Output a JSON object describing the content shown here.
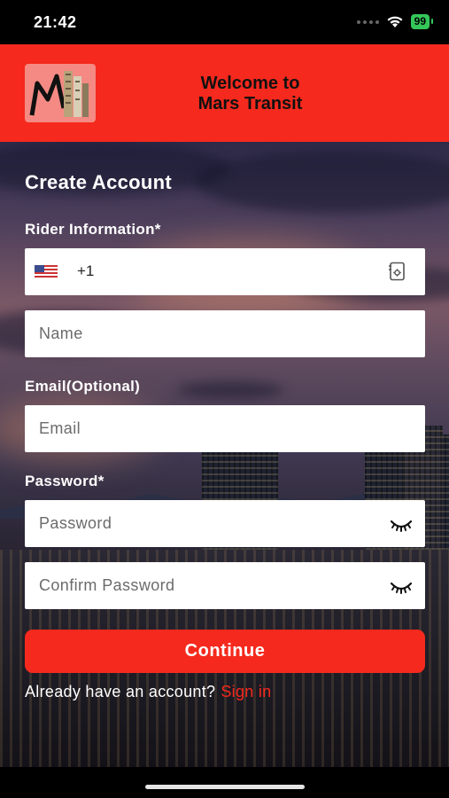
{
  "status_bar": {
    "time": "21:42",
    "battery": "99"
  },
  "header": {
    "title_line1": "Welcome to",
    "title_line2": "Mars Transit",
    "logo_icon": "mars-transit-logo"
  },
  "form": {
    "title": "Create Account",
    "rider_label": "Rider Information*",
    "phone": {
      "dial_code": "+1",
      "value": "",
      "flag_icon": "us-flag-icon",
      "contact_icon": "contact-book-icon"
    },
    "name": {
      "placeholder": "Name",
      "value": ""
    },
    "email_label": "Email(Optional)",
    "email": {
      "placeholder": "Email",
      "value": ""
    },
    "password_label": "Password*",
    "password": {
      "placeholder": "Password",
      "value": "",
      "toggle_icon": "eye-closed-icon"
    },
    "confirm_password": {
      "placeholder": "Confirm Password",
      "value": "",
      "toggle_icon": "eye-closed-icon"
    },
    "continue_label": "Continue",
    "signin_prompt": "Already have an account?",
    "signin_link": "Sign in"
  },
  "colors": {
    "brand_red": "#f5291d",
    "text_dark": "#111111",
    "white": "#ffffff"
  }
}
